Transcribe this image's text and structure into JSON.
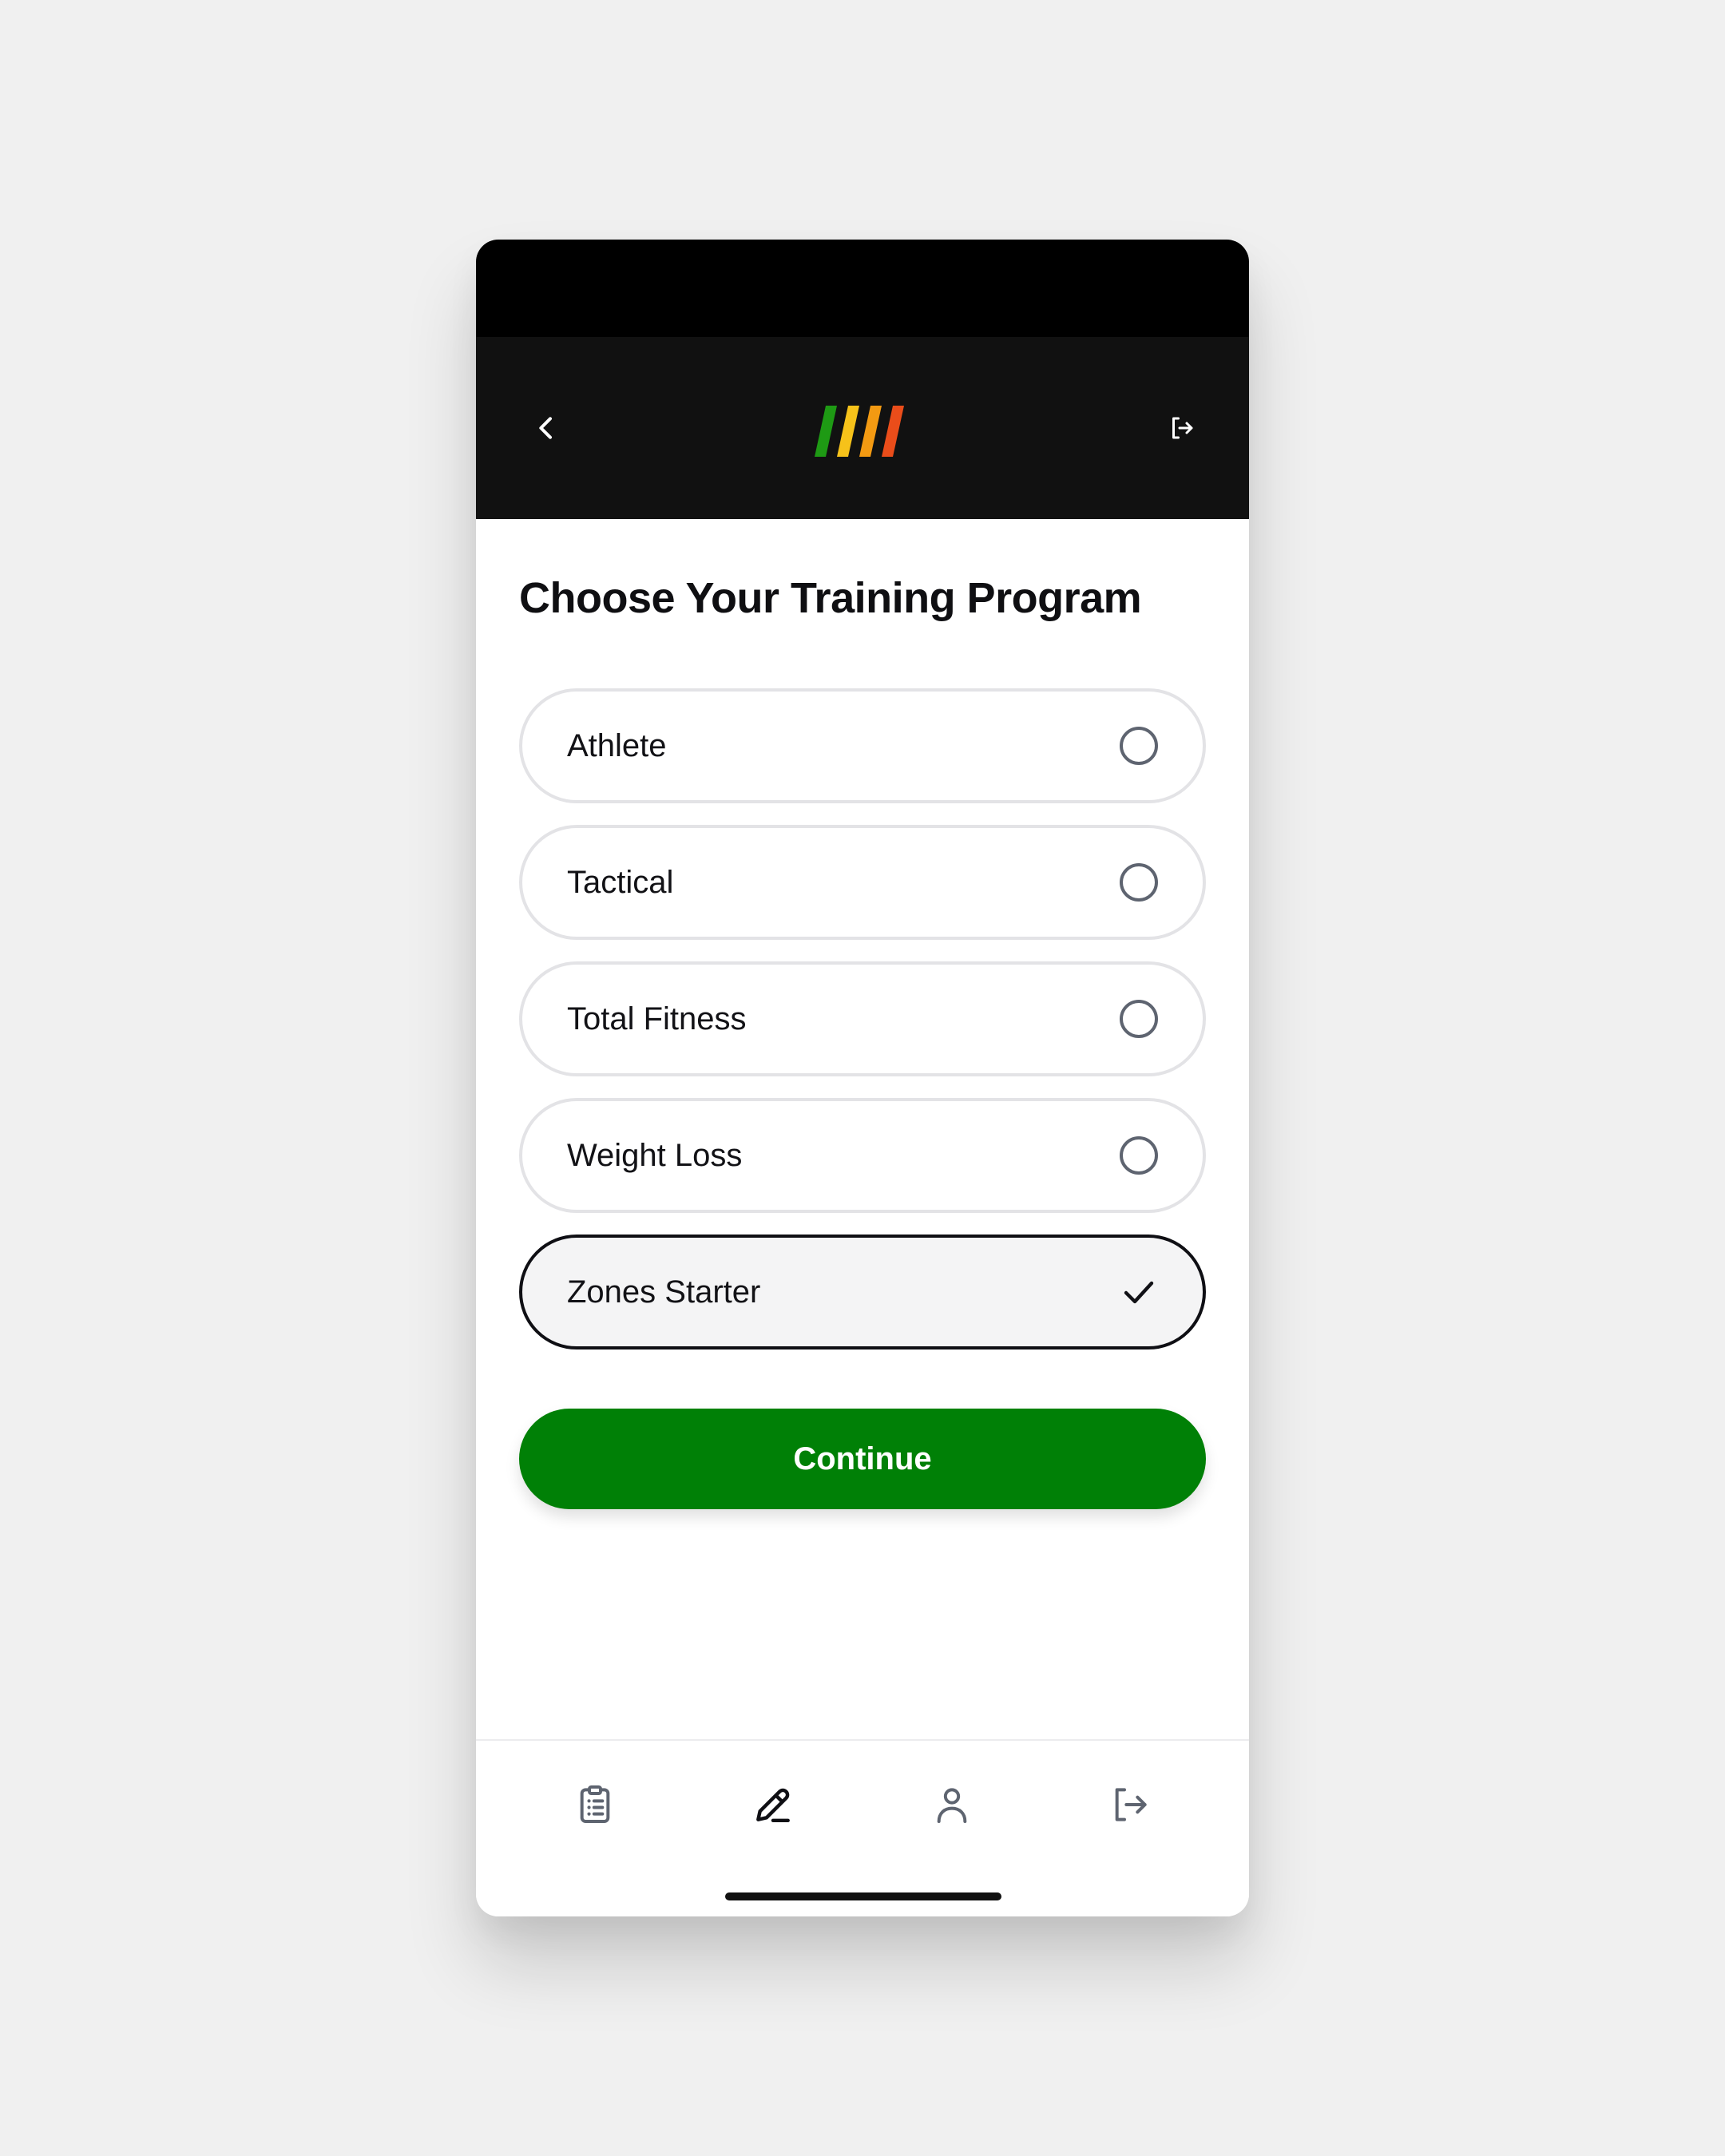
{
  "header": {
    "back_icon": "chevron-left-icon",
    "logo": {
      "stripe_colors": [
        "#1e9a14",
        "#f6c21a",
        "#f39a12",
        "#ea4d1a"
      ]
    },
    "exit_icon": "log-out-icon"
  },
  "page": {
    "title": "Choose Your Training Program"
  },
  "options": [
    {
      "label": "Athlete",
      "selected": false
    },
    {
      "label": "Tactical",
      "selected": false
    },
    {
      "label": "Total Fitness",
      "selected": false
    },
    {
      "label": "Weight Loss",
      "selected": false
    },
    {
      "label": "Zones Starter",
      "selected": true
    }
  ],
  "continue_button": {
    "label": "Continue",
    "color": "#008006"
  },
  "tab_bar": {
    "tabs": [
      {
        "icon": "clipboard-list-icon",
        "active": false
      },
      {
        "icon": "pencil-icon",
        "active": true
      },
      {
        "icon": "user-icon",
        "active": false
      },
      {
        "icon": "log-out-icon",
        "active": false
      }
    ]
  }
}
